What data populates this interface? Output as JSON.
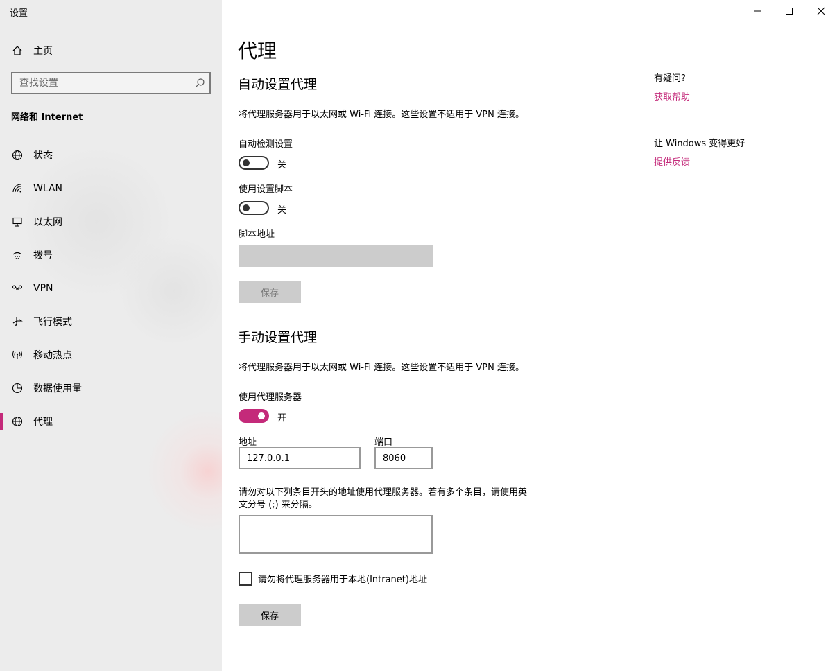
{
  "window": {
    "title": "设置",
    "controls": {
      "minimize": "minimize-icon",
      "maximize": "maximize-icon",
      "close": "close-icon"
    }
  },
  "sidebar": {
    "home_label": "主页",
    "search_placeholder": "查找设置",
    "section_header": "网络和 Internet",
    "items": [
      {
        "label": "状态",
        "icon": "globe-status-icon"
      },
      {
        "label": "WLAN",
        "icon": "wifi-icon"
      },
      {
        "label": "以太网",
        "icon": "ethernet-icon"
      },
      {
        "label": "拨号",
        "icon": "dialup-icon"
      },
      {
        "label": "VPN",
        "icon": "vpn-icon"
      },
      {
        "label": "飞行模式",
        "icon": "airplane-icon"
      },
      {
        "label": "移动热点",
        "icon": "hotspot-icon"
      },
      {
        "label": "数据使用量",
        "icon": "data-usage-icon"
      },
      {
        "label": "代理",
        "icon": "globe-icon",
        "active": true
      }
    ],
    "accent_color": "#c42a7a"
  },
  "main": {
    "title": "代理",
    "auto": {
      "heading": "自动设置代理",
      "description": "将代理服务器用于以太网或 Wi-Fi 连接。这些设置不适用于 VPN 连接。",
      "detect_label": "自动检测设置",
      "detect_state": "关",
      "script_label": "使用设置脚本",
      "script_state": "关",
      "address_label": "脚本地址",
      "address_value": "",
      "save_label": "保存"
    },
    "manual": {
      "heading": "手动设置代理",
      "description": "将代理服务器用于以太网或 Wi-Fi 连接。这些设置不适用于 VPN 连接。",
      "use_proxy_label": "使用代理服务器",
      "use_proxy_state": "开",
      "address_label": "地址",
      "address_value": "127.0.0.1",
      "port_label": "端口",
      "port_value": "8060",
      "exceptions_line1": "请勿对以下列条目开头的地址使用代理服务器。若有多个条目，请使用英",
      "exceptions_line2": "文分号 (;) 来分隔。",
      "exceptions_value": "",
      "bypass_local_label": "请勿将代理服务器用于本地(Intranet)地址",
      "save_label": "保存"
    }
  },
  "help": {
    "question_label": "有疑问?",
    "get_help_link": "获取帮助",
    "improve_label": "让 Windows 变得更好",
    "feedback_link": "提供反馈"
  }
}
